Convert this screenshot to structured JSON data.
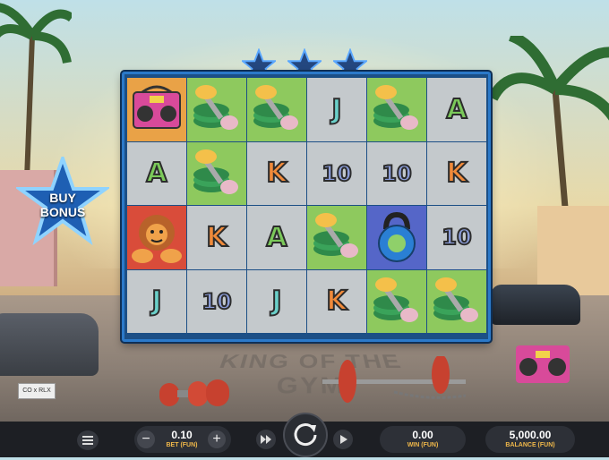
{
  "game": {
    "background_text": "KING OF THE GYM",
    "plate_text": "CO x RLX",
    "stars_count": 3,
    "buy_bonus": {
      "line1": "BUY",
      "line2": "BONUS"
    }
  },
  "reels": {
    "rows": [
      [
        {
          "symbol": "boombox",
          "bg": "orange"
        },
        {
          "symbol": "dumbbell-plates",
          "bg": "green"
        },
        {
          "symbol": "dumbbell-plates",
          "bg": "green"
        },
        {
          "symbol": "J",
          "bg": "grey"
        },
        {
          "symbol": "dumbbell-plates",
          "bg": "green"
        },
        {
          "symbol": "A",
          "bg": "grey"
        }
      ],
      [
        {
          "symbol": "A",
          "bg": "grey"
        },
        {
          "symbol": "dumbbell-plates",
          "bg": "green"
        },
        {
          "symbol": "K",
          "bg": "grey"
        },
        {
          "symbol": "10",
          "bg": "grey"
        },
        {
          "symbol": "10",
          "bg": "grey"
        },
        {
          "symbol": "K",
          "bg": "grey"
        }
      ],
      [
        {
          "symbol": "lion",
          "bg": "red"
        },
        {
          "symbol": "K",
          "bg": "grey"
        },
        {
          "symbol": "A",
          "bg": "grey"
        },
        {
          "symbol": "dumbbell-plates",
          "bg": "green"
        },
        {
          "symbol": "kettlebell",
          "bg": "blue"
        },
        {
          "symbol": "10",
          "bg": "grey"
        }
      ],
      [
        {
          "symbol": "J",
          "bg": "grey"
        },
        {
          "symbol": "10",
          "bg": "grey"
        },
        {
          "symbol": "J",
          "bg": "grey"
        },
        {
          "symbol": "K",
          "bg": "grey"
        },
        {
          "symbol": "dumbbell-plates",
          "bg": "green"
        },
        {
          "symbol": "dumbbell-plates",
          "bg": "green"
        }
      ]
    ]
  },
  "controls": {
    "bet": {
      "value": "0.10",
      "label": "BET (FUN)"
    },
    "win": {
      "value": "0.00",
      "label": "WIN (FUN)"
    },
    "balance": {
      "value": "5,000.00",
      "label": "BALANCE (FUN)"
    },
    "icons": {
      "menu": "menu-icon",
      "minus": "minus-icon",
      "plus": "plus-icon",
      "turbo": "fast-forward-icon",
      "spin": "spin-icon",
      "autoplay": "play-icon"
    }
  },
  "colors": {
    "frame": "#2b79c9",
    "star": "#2b79c9",
    "accent_label": "#f0b84a",
    "bar": "#1d1f24"
  }
}
